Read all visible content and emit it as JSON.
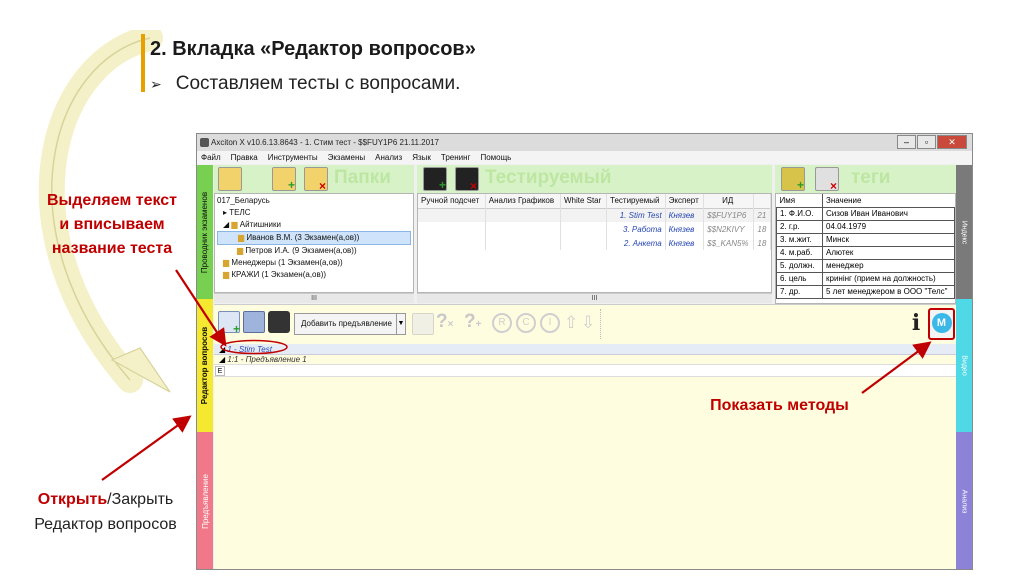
{
  "slide": {
    "title": "2. Вкладка «Редактор вопросов»",
    "bullet": "Составляем тесты с вопросами.",
    "bullet_icon": "arrow-bullet-icon",
    "annotation_select": "Выделяем текст и вписываем название теста",
    "annotation_select_lines": [
      "Выделяем текст",
      "и вписываем",
      "название теста"
    ],
    "annotation_methods": "Показать методы",
    "annotation_open_bold": "Открыть",
    "annotation_open_rest": "/Закрыть",
    "annotation_open_line2": "Редактор вопросов"
  },
  "app": {
    "title": "Axciton X v10.6.13.8643 - 1. Стим тест - $$FUY1P6 21.11.2017",
    "menu": [
      "Файл",
      "Правка",
      "Инструменты",
      "Экзамены",
      "Анализ",
      "Язык",
      "Тренинг",
      "Помощь"
    ],
    "left_tabs": {
      "top": "Проводник экзаменов",
      "mid": "Редактор вопросов",
      "bottom": "Предъявление"
    },
    "right_tabs": {
      "top": "Индекс",
      "mid": "Видео",
      "bottom": "Анализ"
    },
    "folders_header": "Папки",
    "subject_header": "Тестируемый",
    "tags_header": "теги",
    "tree": [
      "017_Беларусь",
      "ТЕЛС",
      "Айтишники",
      "Иванов В.М. (3 Экзамен(а,ов))",
      "Петров И.А. (9 Экзамен(а,ов))",
      "Менеджеры (1 Экзамен(а,ов))",
      "КРАЖИ (1 Экзамен(а,ов))"
    ],
    "exam_columns": [
      "Ручной подсчет",
      "Анализ Графиков",
      "White Star",
      "Тестируемый",
      "Эксперт",
      "ИД"
    ],
    "exam_rows": [
      {
        "name": "1. Stim Test",
        "expert": "Князев",
        "id": "$$FUY1P6",
        "n": "21"
      },
      {
        "name": "3. Работа",
        "expert": "Князев",
        "id": "$$N2KIVY",
        "n": "18"
      },
      {
        "name": "2. Анкета",
        "expert": "Князев",
        "id": "$$_KAN5%",
        "n": "18"
      }
    ],
    "tags_columns": [
      "Имя",
      "Значение"
    ],
    "tags_rows": [
      [
        "1. Ф.И.О.",
        "Сизов Иван Иванович"
      ],
      [
        "2. г.р.",
        "04.04.1979"
      ],
      [
        "3. м.жит.",
        "Минск"
      ],
      [
        "4. м.раб.",
        "Алютек"
      ],
      [
        "5. должн.",
        "менеджер"
      ],
      [
        "6. цель",
        "кринінг (прием на должность)"
      ],
      [
        "7. др.",
        "5 лет менеджером в ООО \"Телс\""
      ]
    ],
    "add_presentation": "Добавить предъявление",
    "scroll_label": "III",
    "editor": {
      "test_name": "1 - Stim Test",
      "presentation": "1:1 - Предъявление 1",
      "question_marker": "E"
    },
    "colors": {
      "accent_red": "#c00000",
      "header_green": "#d8f2c8",
      "tab_cyan": "#4fd8e6",
      "tab_purple": "#8c82d8",
      "tab_pink": "#f07888",
      "tab_gray": "#7a7a7a"
    }
  }
}
